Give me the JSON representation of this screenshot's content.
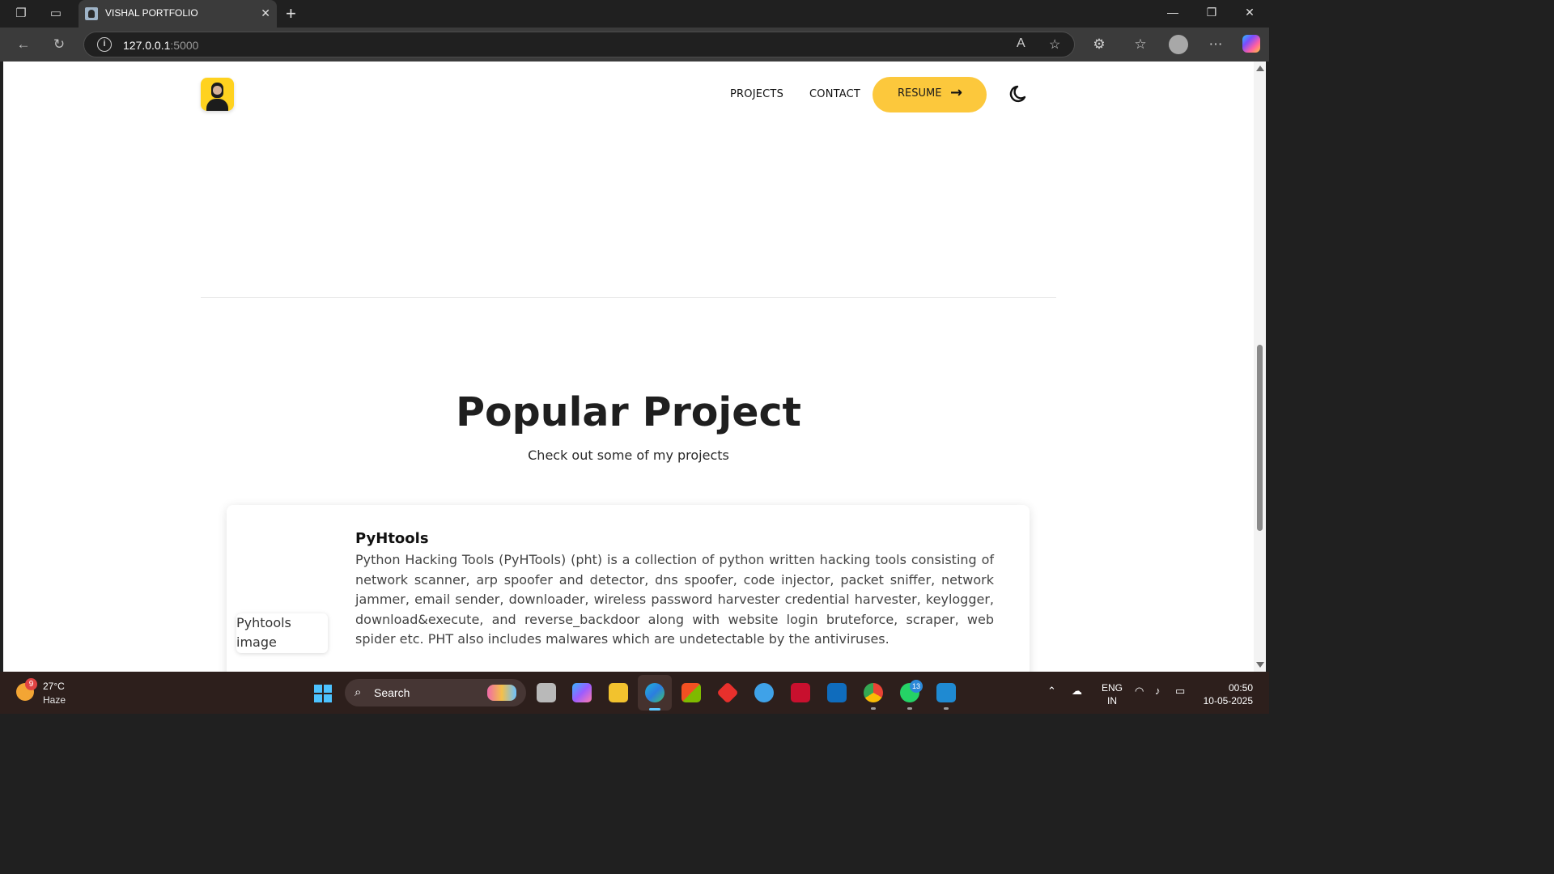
{
  "browser": {
    "tab_title": "VISHAL PORTFOLIO",
    "url_host": "127.0.0.1",
    "url_port": ":5000"
  },
  "nav": {
    "projects_label": "PROJECTS",
    "contact_label": "CONTACT",
    "resume_label": "RESUME"
  },
  "section": {
    "title": "Popular Project",
    "subtitle": "Check out some of my projects"
  },
  "project": {
    "image_alt": "Pyhtools image",
    "title": "PyHtools",
    "description": "Python Hacking Tools (PyHTools) (pht) is a collection of python written hacking tools consisting of network scanner, arp spoofer and detector, dns spoofer, code injector, packet sniffer, network jammer, email sender, downloader, wireless password harvester credential harvester, keylogger, download&execute, and reverse_backdoor along with website login bruteforce, scraper, web spider etc. PHT also includes malwares which are undetectable by the antiviruses."
  },
  "taskbar": {
    "weather_badge": "9",
    "temperature": "27°C",
    "condition": "Haze",
    "search_label": "Search",
    "whatsapp_badge": "13",
    "lang_line1": "ENG",
    "lang_line2": "IN",
    "time": "00:50",
    "date": "10-05-2025"
  },
  "colors": {
    "accent": "#fcc83c",
    "logo_bg": "#ffd21f",
    "browser_chrome": "#3b3b3b",
    "taskbar": "#2d1f1c"
  },
  "icons": [
    "workspaces-icon",
    "tab-actions-icon",
    "close-icon",
    "new-tab-icon",
    "minimize-icon",
    "maximize-icon",
    "back-icon",
    "refresh-icon",
    "info-icon",
    "read-aloud-icon",
    "favorite-star-icon",
    "extensions-icon",
    "favorites-icon",
    "profile-icon",
    "more-icon",
    "copilot-icon",
    "arrow-right-icon",
    "moon-icon",
    "windows-start-icon",
    "search-icon"
  ]
}
